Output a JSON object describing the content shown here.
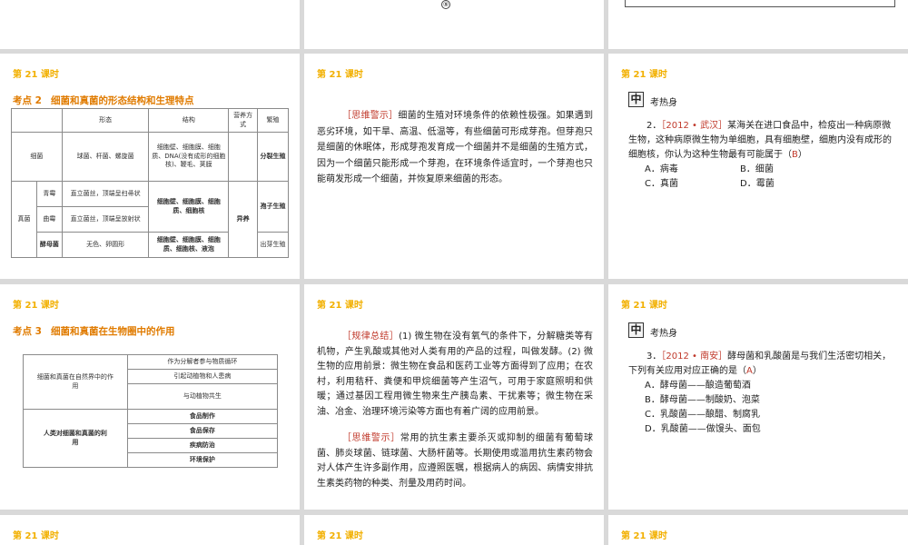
{
  "header": "第 21 课时",
  "top": {
    "circled_number": "⑨"
  },
  "slide1": {
    "point": "考点 2",
    "title": "细菌和真菌的形态结构和生理特点",
    "headers": [
      "形态",
      "结构",
      "营养方式",
      "繁殖"
    ],
    "bacteria": {
      "name": "细菌",
      "shape": "球菌、杆菌、螺旋菌",
      "structure": "细胞壁、细胞膜、细胞质、DNA(没有成形的细胞核)、鞭毛、荚膜",
      "reproduction": "分裂生殖"
    },
    "fungi_label": "真菌",
    "nutrition": "异养",
    "qingmei": {
      "name": "青霉",
      "shape": "直立菌丝，顶端呈扫帚状"
    },
    "qumei": {
      "name": "曲霉",
      "shape": "直立菌丝，顶端呈放射状"
    },
    "mold_structure": "细胞壁、细胞膜、细胞质、细胞核",
    "mold_reproduction": "孢子生殖",
    "yeast": {
      "name": "酵母菌",
      "shape": "无色、卵圆形",
      "structure": "细胞壁、细胞膜、细胞质、细胞核、液泡",
      "reproduction": "出芽生殖"
    }
  },
  "slide2": {
    "tag": "［思维警示］",
    "text": "细菌的生殖对环境条件的依赖性极强。如果遇到恶劣环境，如干旱、高温、低温等，有些细菌可形成芽孢。但芽孢只是细菌的休眠体，形成芽孢发育成一个细菌并不是细菌的生殖方式，因为一个细菌只能形成一个芽孢，在环境条件适宜时，一个芽孢也只能萌发形成一个细菌，并恢复原来细菌的形态。"
  },
  "slide3": {
    "box": "中",
    "label": "考热身",
    "num": "2．",
    "source": "［2012 • 武汉］",
    "question": "某海关在进口食品中，检疫出一种病原微生物，这种病原微生物为单细胞，具有细胞壁，细胞内没有成形的细胞核，你认为这种生物最有可能属于（",
    "answer": "B",
    "close": "）",
    "optA": "A．病毒",
    "optB": "B．细菌",
    "optC": "C．真菌",
    "optD": "D．霉菌"
  },
  "slide4": {
    "point": "考点 3",
    "title": "细菌和真菌在生物圈中的作用",
    "role_label": "细菌和真菌在自然界中的作用",
    "roles": [
      "作为分解者参与物质循环",
      "引起动植物和人患病",
      "与动植物共生"
    ],
    "use_label": "人类对细菌和真菌的利用",
    "uses": [
      "食品制作",
      "食品保存",
      "疾病防治",
      "环境保护"
    ]
  },
  "slide5": {
    "tag1": "［规律总结］",
    "text1": "(1) 微生物在没有氧气的条件下，分解糖类等有机物，产生乳酸或其他对人类有用的产品的过程，叫做发酵。(2) 微生物的应用前景：微生物在食品和医药工业等方面得到了应用；在农村，利用秸秆、粪便和甲烷细菌等产生沼气，可用于家庭照明和供暖；通过基因工程用微生物来生产胰岛素、干扰素等；微生物在采油、冶金、治理环境污染等方面也有着广阔的应用前景。",
    "tag2": "［思维警示］",
    "text2": "常用的抗生素主要杀灭或抑制的细菌有葡萄球菌、肺炎球菌、链球菌、大肠杆菌等。长期使用或滥用抗生素药物会对人体产生许多副作用，应遵照医嘱，根据病人的病因、病情安排抗生素类药物的种类、剂量及用药时间。"
  },
  "slide6": {
    "box": "中",
    "label": "考热身",
    "num": "3．",
    "source": "［2012 • 南安］",
    "question": "酵母菌和乳酸菌是与我们生活密切相关，下列有关应用对应正确的是（",
    "answer": "A",
    "close": "）",
    "options": [
      "A．酵母菌——酿造葡萄酒",
      "B．酵母菌——制酸奶、泡菜",
      "C．乳酸菌——酿醋、制腐乳",
      "D．乳酸菌——做馒头、面包"
    ]
  }
}
